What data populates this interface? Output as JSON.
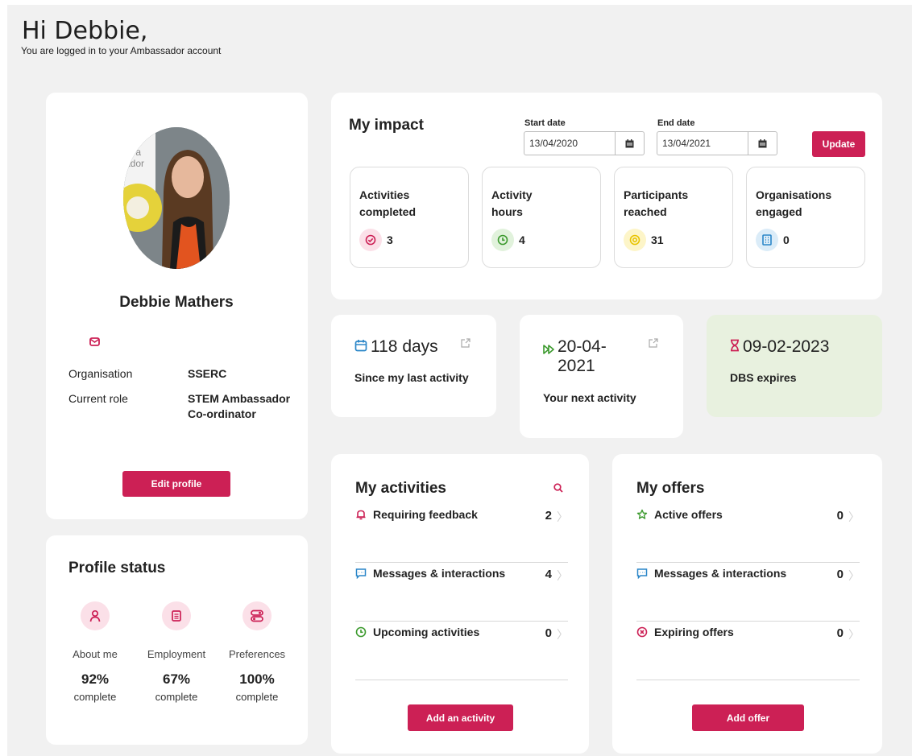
{
  "greeting": {
    "title": "Hi Debbie,",
    "subtitle": "You are logged in to your Ambassador account"
  },
  "profile": {
    "name": "Debbie Mathers",
    "organisation_label": "Organisation",
    "organisation_value": "SSERC",
    "role_label": "Current role",
    "role_value": "STEM Ambassador Co-ordinator",
    "photo_bg_text": "th a ador",
    "edit_button": "Edit profile"
  },
  "profile_status": {
    "title": "Profile status",
    "items": [
      {
        "label": "About me",
        "percent": "92%",
        "sub": "complete",
        "icon": "person-icon"
      },
      {
        "label": "Employment",
        "percent": "67%",
        "sub": "complete",
        "icon": "document-icon"
      },
      {
        "label": "Preferences",
        "percent": "100%",
        "sub": "complete",
        "icon": "toggles-icon"
      }
    ]
  },
  "impact": {
    "title": "My impact",
    "start_label": "Start date",
    "start_value": "13/04/2020",
    "end_label": "End date",
    "end_value": "13/04/2021",
    "update_button": "Update",
    "stats": [
      {
        "label": "Activities completed",
        "value": "3",
        "icon": "check-circle-icon",
        "color": "#cc2055",
        "bg": "#fbe0e8"
      },
      {
        "label": "Activity hours",
        "value": "4",
        "icon": "clock-icon",
        "color": "#3c9a2e",
        "bg": "#e1f2dc"
      },
      {
        "label": "Participants reached",
        "value": "31",
        "icon": "target-icon",
        "color": "#e8c300",
        "bg": "#fdf5c8"
      },
      {
        "label": "Organisations engaged",
        "value": "0",
        "icon": "building-icon",
        "color": "#2a86c8",
        "bg": "#dbecf8"
      }
    ]
  },
  "last_activity": {
    "big": "118 days",
    "sub": "Since my last activity"
  },
  "next_activity": {
    "big": "20-04-2021",
    "sub": "Your next activity"
  },
  "dbs": {
    "big": "09-02-2023",
    "sub": "DBS expires"
  },
  "activities": {
    "title": "My activities",
    "rows": [
      {
        "label": "Requiring feedback",
        "count": "2",
        "icon": "bell-icon"
      },
      {
        "label": "Messages & interactions",
        "count": "4",
        "icon": "chat-icon"
      },
      {
        "label": "Upcoming activities",
        "count": "0",
        "icon": "clock-icon"
      }
    ],
    "button": "Add an activity"
  },
  "offers": {
    "title": "My offers",
    "rows": [
      {
        "label": "Active offers",
        "count": "0",
        "icon": "star-icon"
      },
      {
        "label": "Messages & interactions",
        "count": "0",
        "icon": "chat-icon"
      },
      {
        "label": "Expiring offers",
        "count": "0",
        "icon": "x-circle-icon"
      }
    ],
    "button": "Add offer"
  },
  "colors": {
    "accent": "#cc2055",
    "background": "#f1f1f1",
    "dbs_card": "#e8f1df"
  }
}
